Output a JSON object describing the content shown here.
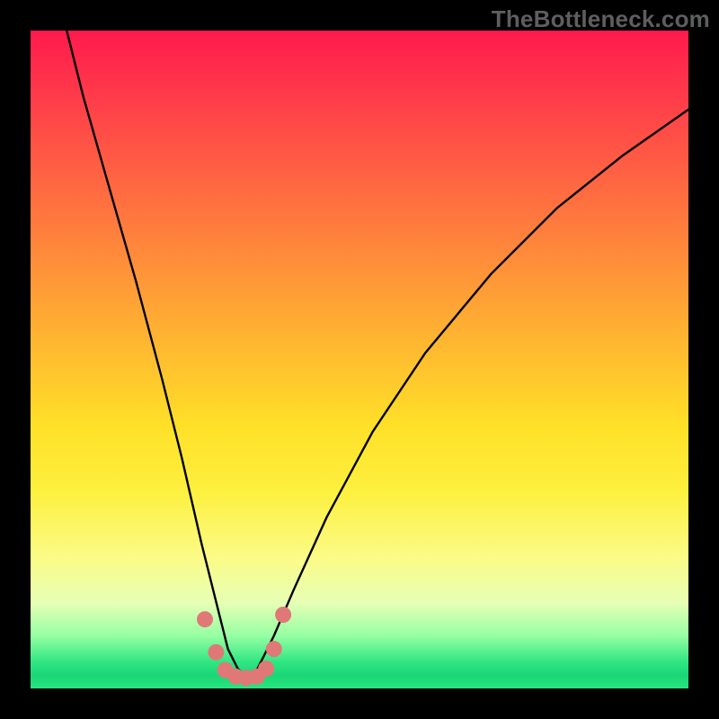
{
  "watermark": "TheBottleneck.com",
  "chart_data": {
    "type": "line",
    "title": "",
    "xlabel": "",
    "ylabel": "",
    "xlim": [
      0,
      100
    ],
    "ylim": [
      0,
      100
    ],
    "series": [
      {
        "name": "bottleneck-curve",
        "x": [
          5,
          8,
          12,
          16,
          20,
          23,
          26,
          28.5,
          30,
          31.5,
          33,
          34.5,
          37,
          40,
          45,
          52,
          60,
          70,
          80,
          90,
          100
        ],
        "y": [
          102,
          90,
          76,
          62,
          47,
          35,
          22,
          12,
          6,
          3,
          1.5,
          3,
          8,
          15,
          26,
          39,
          51,
          63,
          73,
          81,
          88
        ]
      }
    ],
    "markers": {
      "name": "highlight-dots",
      "color": "#e17878",
      "points_x": [
        26.5,
        28.2,
        29.6,
        31.2,
        32.8,
        34.4,
        35.8,
        37.0,
        38.4
      ],
      "points_y": [
        10.5,
        5.5,
        2.8,
        1.8,
        1.6,
        1.8,
        3.0,
        6.0,
        11.2
      ]
    },
    "gradient_stops": [
      {
        "pos": 0,
        "color": "#ff1a4d"
      },
      {
        "pos": 50,
        "color": "#ffbf2f"
      },
      {
        "pos": 80,
        "color": "#fcfb86"
      },
      {
        "pos": 100,
        "color": "#28e480"
      }
    ]
  }
}
